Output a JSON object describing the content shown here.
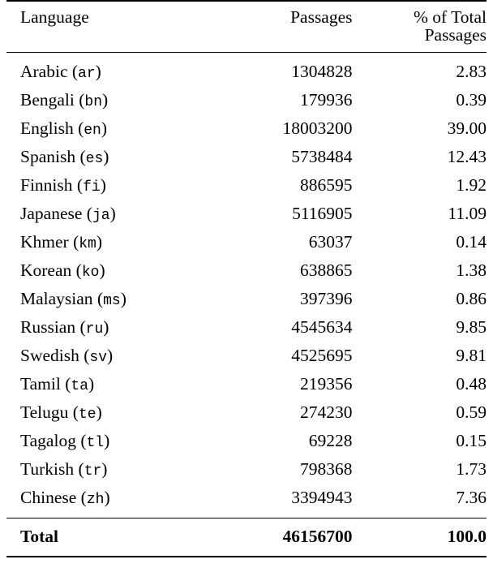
{
  "table": {
    "columns": [
      {
        "key": "language",
        "label": "Language",
        "align": "left"
      },
      {
        "key": "passages",
        "label": "Passages",
        "align": "right"
      },
      {
        "key": "percent",
        "label": "% of Total Passages",
        "align": "right"
      }
    ],
    "rows": [
      {
        "language": "Arabic",
        "code": "ar",
        "passages": "1304828",
        "percent": "2.83"
      },
      {
        "language": "Bengali",
        "code": "bn",
        "passages": "179936",
        "percent": "0.39"
      },
      {
        "language": "English",
        "code": "en",
        "passages": "18003200",
        "percent": "39.00"
      },
      {
        "language": "Spanish",
        "code": "es",
        "passages": "5738484",
        "percent": "12.43"
      },
      {
        "language": "Finnish",
        "code": "fi",
        "passages": "886595",
        "percent": "1.92"
      },
      {
        "language": "Japanese",
        "code": "ja",
        "passages": "5116905",
        "percent": "11.09"
      },
      {
        "language": "Khmer",
        "code": "km",
        "passages": "63037",
        "percent": "0.14"
      },
      {
        "language": "Korean",
        "code": "ko",
        "passages": "638865",
        "percent": "1.38"
      },
      {
        "language": "Malaysian",
        "code": "ms",
        "passages": "397396",
        "percent": "0.86"
      },
      {
        "language": "Russian",
        "code": "ru",
        "passages": "4545634",
        "percent": "9.85"
      },
      {
        "language": "Swedish",
        "code": "sv",
        "passages": "4525695",
        "percent": "9.81"
      },
      {
        "language": "Tamil",
        "code": "ta",
        "passages": "219356",
        "percent": "0.48"
      },
      {
        "language": "Telugu",
        "code": "te",
        "passages": "274230",
        "percent": "0.59"
      },
      {
        "language": "Tagalog",
        "code": "tl",
        "passages": "69228",
        "percent": "0.15"
      },
      {
        "language": "Turkish",
        "code": "tr",
        "passages": "798368",
        "percent": "1.73"
      },
      {
        "language": "Chinese",
        "code": "zh",
        "passages": "3394943",
        "percent": "7.36"
      }
    ],
    "total": {
      "label": "Total",
      "passages": "46156700",
      "percent": "100.0"
    },
    "paren_open": "(",
    "paren_close": ")"
  }
}
